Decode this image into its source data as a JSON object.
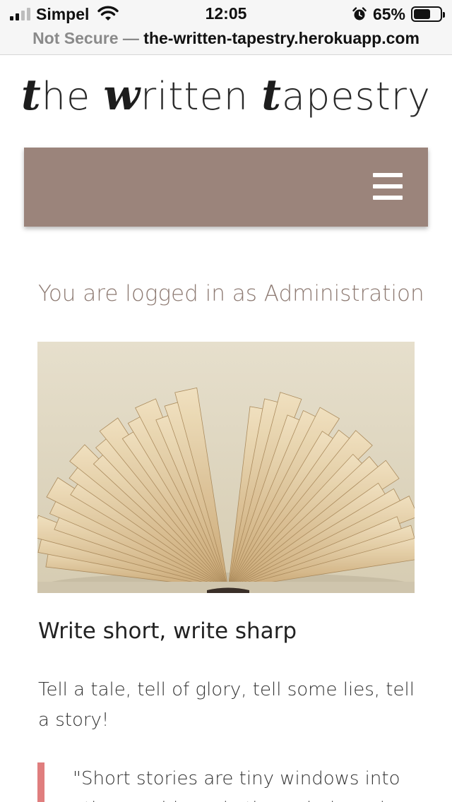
{
  "status_bar": {
    "carrier": "Simpel",
    "time": "12:05",
    "battery_percent": "65%",
    "battery_level": 0.65,
    "icons": [
      "signal-icon",
      "wifi-icon",
      "alarm-icon",
      "battery-icon"
    ]
  },
  "browser": {
    "security_label": "Not Secure",
    "separator": " — ",
    "host": "the-written-tapestry.herokuapp.com"
  },
  "site": {
    "logo": {
      "part1_script": "t",
      "part1_rest": "he ",
      "part2_script": "w",
      "part2_rest": "ritten ",
      "part3_script": "t",
      "part3_rest": "apestry"
    },
    "nav_color": "#9b847b",
    "menu_icon": "hamburger-menu-icon"
  },
  "main": {
    "logged_in_text": "You are logged in as Administration",
    "hero_image": "open-book-pages",
    "post_title": "Write short, write sharp",
    "post_intro": "Tell a tale, tell of glory, tell some lies, tell a story!",
    "quote": "\"Short stories are tiny windows into other worlds and other minds and",
    "quote_accent": "#e07e7e"
  }
}
